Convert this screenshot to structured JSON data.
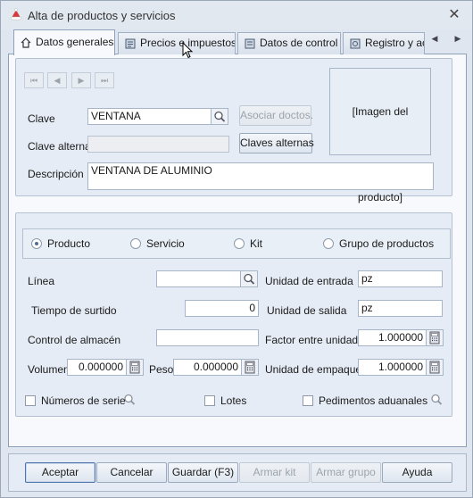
{
  "window": {
    "title": "Alta de productos y servicios",
    "close_glyph": "✕"
  },
  "tabs": [
    {
      "label": "Datos generales",
      "icon": "home-icon",
      "active": true
    },
    {
      "label": "Precios e impuestos",
      "icon": "price-list-icon",
      "active": false
    },
    {
      "label": "Datos de control",
      "icon": "control-icon",
      "active": false
    },
    {
      "label": "Registro y ac",
      "icon": "registry-icon",
      "active": false
    }
  ],
  "nav": {
    "first": "⏮",
    "prev": "◀",
    "next": "▶",
    "last": "⏭"
  },
  "general": {
    "clave_label": "Clave",
    "clave_value": "VENTANA",
    "asociar_label": "Asociar doctos.",
    "clave_alterna_label": "Clave alterna",
    "clave_alterna_value": "",
    "claves_alternas_button": "Claves alternas",
    "descripcion_label": "Descripción",
    "descripcion_value": "VENTANA DE ALUMINIO",
    "image_placeholder": "[Imagen del producto]"
  },
  "type_options": [
    {
      "label": "Producto",
      "checked": true
    },
    {
      "label": "Servicio",
      "checked": false
    },
    {
      "label": "Kit",
      "checked": false
    },
    {
      "label": "Grupo de productos",
      "checked": false
    }
  ],
  "details": {
    "linea_label": "Línea",
    "linea_value": "",
    "tiempo_label": "Tiempo de surtido",
    "tiempo_value": "0",
    "control_almacen_label": "Control de almacén",
    "control_almacen_value": "",
    "volumen_label": "Volumen",
    "volumen_value": "0.000000",
    "peso_label": "Peso",
    "peso_value": "0.000000",
    "unidad_entrada_label": "Unidad de entrada",
    "unidad_entrada_value": "pz",
    "unidad_salida_label": "Unidad de salida",
    "unidad_salida_value": "pz",
    "factor_label": "Factor entre unidades",
    "factor_value": "1.000000",
    "unidad_empaque_label": "Unidad de empaque",
    "unidad_empaque_value": "1.000000",
    "numeros_serie_label": "Números de serie",
    "lotes_label": "Lotes",
    "pedimentos_label": "Pedimentos aduanales"
  },
  "buttons": {
    "aceptar": "Aceptar",
    "cancelar": "Cancelar",
    "guardar": "Guardar (F3)",
    "armar_kit": "Armar kit",
    "armar_grupo": "Armar grupo",
    "ayuda": "Ayuda"
  }
}
